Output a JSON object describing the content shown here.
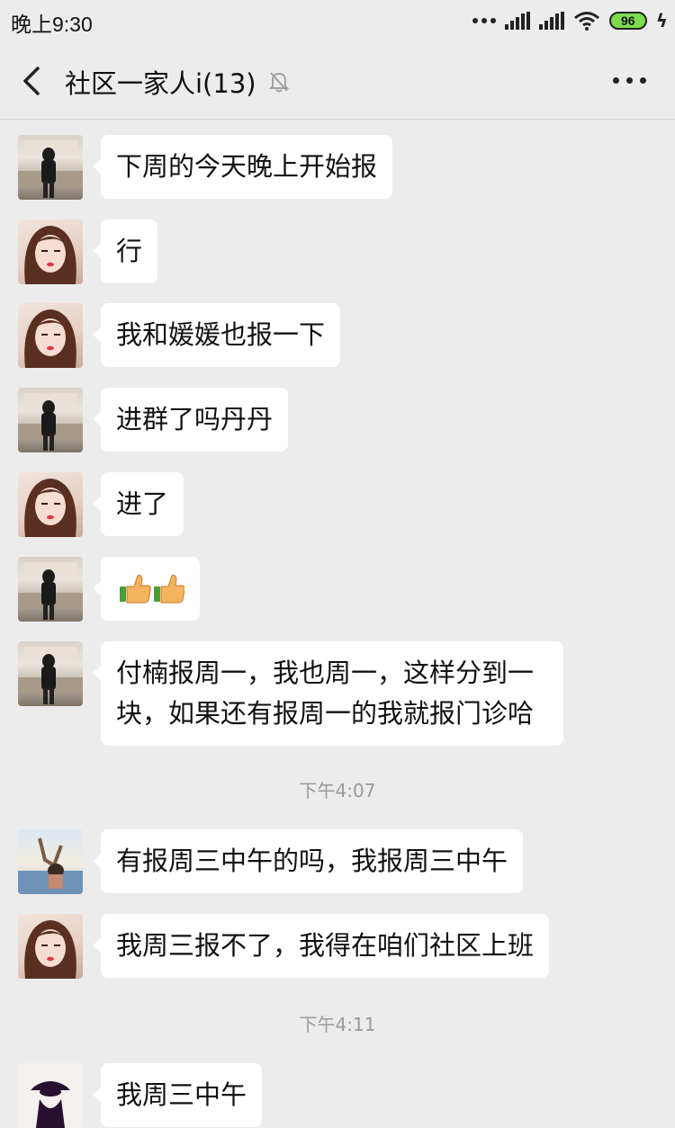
{
  "status": {
    "time": "晚上9:30",
    "battery": "96"
  },
  "nav": {
    "title": "社区一家人i(13)"
  },
  "messages": [
    {
      "text": "下周的今天晚上开始报"
    },
    {
      "text": "行"
    },
    {
      "text": "我和媛媛也报一下"
    },
    {
      "text": "进群了吗丹丹"
    },
    {
      "text": "进了"
    },
    {
      "text": "👍👍"
    },
    {
      "text": "付楠报周一，我也周一，这样分到一块，如果还有报周一的我就报门诊哈"
    },
    {
      "text": "有报周三中午的吗，我报周三中午"
    },
    {
      "text": "我周三报不了，我得在咱们社区上班"
    },
    {
      "text": "我周三中午"
    }
  ],
  "timestamps": [
    "下午4:07",
    "下午4:11"
  ]
}
